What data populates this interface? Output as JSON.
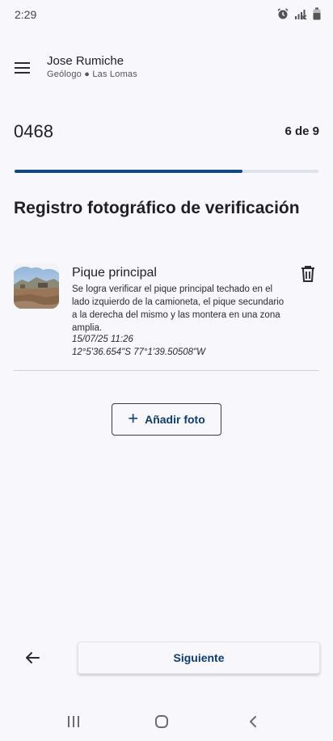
{
  "status_bar": {
    "time": "2:29",
    "icons": [
      "alarm-icon",
      "signal-off-icon",
      "battery-icon"
    ]
  },
  "header": {
    "menu_icon": "hamburger-menu-icon",
    "user_name": "Jose Rumiche",
    "user_role": "Geólogo ● Las Lomas"
  },
  "progress": {
    "record_id": "0468",
    "step_label": "6 de 9",
    "current": 6,
    "total": 9,
    "fill_fraction": 0.75,
    "fill_color": "#0e4a80"
  },
  "section": {
    "title": "Registro fotográfico de verificación"
  },
  "photos": [
    {
      "title": "Pique principal",
      "description": "Se logra verificar el pique principal techado en el lado izquierdo de la camioneta, el pique secundario a la derecha del mismo y las montera en una zona amplia.",
      "datetime": "15/07/25 11:26",
      "coordinates": "12°5'36.654\"S 77°1'39.50508\"W",
      "delete_icon": "trash-icon"
    }
  ],
  "actions": {
    "add_photo_label": "Añadir foto",
    "add_icon": "plus-icon",
    "back_icon": "arrow-left-icon",
    "next_label": "Siguiente"
  },
  "colors": {
    "accent": "#0e3d6b",
    "background": "#f7f7fc"
  }
}
